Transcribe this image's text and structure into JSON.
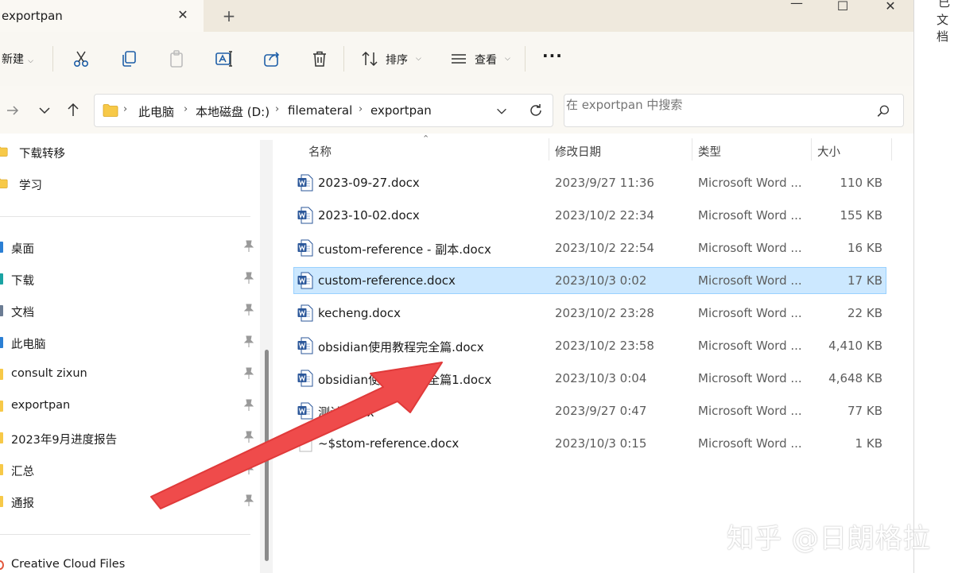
{
  "tab": {
    "title": "exportpan",
    "close": "✕",
    "new_tab": "+"
  },
  "window_controls": {
    "minimize": "—",
    "maximize": "☐",
    "close": "✕"
  },
  "toolbar": {
    "new_label": "新建",
    "sort_label": "排序",
    "view_label": "查看",
    "more_label": "···"
  },
  "address": {
    "crumbs": [
      "此电脑",
      "本地磁盘 (D:)",
      "filemateral",
      "exportpan"
    ],
    "search_placeholder": "在 exportpan 中搜索"
  },
  "nav": {
    "top_items": [
      "下载转移",
      "学习"
    ],
    "quick_items": [
      "桌面",
      "下载",
      "文档",
      "此电脑",
      "consult zixun",
      "exportpan",
      "2023年9月进度报告",
      "汇总",
      "通报"
    ],
    "bottom_item": "Creative Cloud Files"
  },
  "columns": {
    "name": "名称",
    "date": "修改日期",
    "type": "类型",
    "size": "大小"
  },
  "files": [
    {
      "name": "2023-09-27.docx",
      "date": "2023/9/27 11:36",
      "type": "Microsoft Word ...",
      "size": "110 KB"
    },
    {
      "name": "2023-10-02.docx",
      "date": "2023/10/2 22:34",
      "type": "Microsoft Word ...",
      "size": "155 KB"
    },
    {
      "name": "custom-reference - 副本.docx",
      "date": "2023/10/2 22:54",
      "type": "Microsoft Word ...",
      "size": "16 KB"
    },
    {
      "name": "custom-reference.docx",
      "date": "2023/10/3 0:02",
      "type": "Microsoft Word ...",
      "size": "17 KB"
    },
    {
      "name": "kecheng.docx",
      "date": "2023/10/2 23:28",
      "type": "Microsoft Word ...",
      "size": "22 KB"
    },
    {
      "name": "obsidian使用教程完全篇.docx",
      "date": "2023/10/2 23:58",
      "type": "Microsoft Word ...",
      "size": "4,410 KB"
    },
    {
      "name": "obsidian使用教程完全篇1.docx",
      "date": "2023/10/3 0:04",
      "type": "Microsoft Word ...",
      "size": "4,648 KB"
    },
    {
      "name": "测试.docx",
      "date": "2023/9/27 0:47",
      "type": "Microsoft Word ...",
      "size": "77 KB"
    },
    {
      "name": "~$stom-reference.docx",
      "date": "2023/10/3 0:15",
      "type": "Microsoft Word ...",
      "size": "1 KB"
    }
  ],
  "selected_file": "custom-reference.docx",
  "right_pane": {
    "top": "已",
    "text": "文档"
  },
  "watermark": "知乎 @日朗格拉",
  "colors": {
    "arrow": "#ef4b4b",
    "selection": "#cce8ff",
    "folder": "#f7c948",
    "word_blue": "#2b579a"
  }
}
